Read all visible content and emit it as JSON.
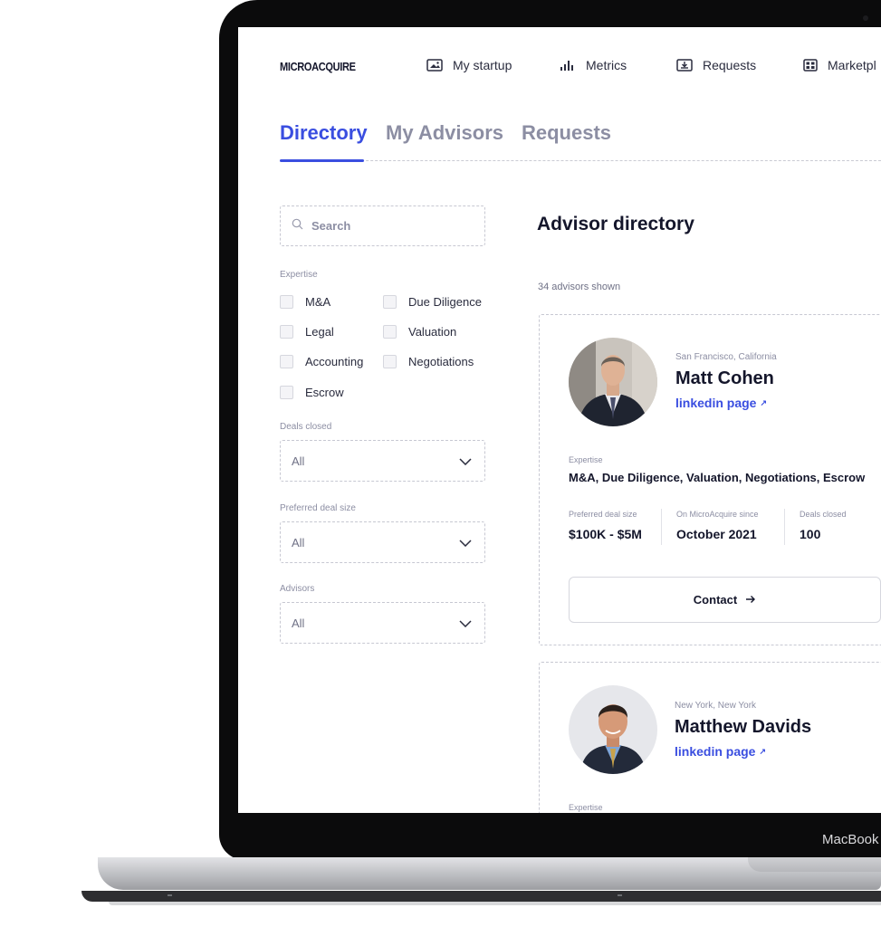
{
  "device": {
    "chin_label": "MacBook"
  },
  "header": {
    "logo": "MICROACQUIRE",
    "nav": [
      {
        "label": "My startup",
        "icon": "image-icon"
      },
      {
        "label": "Metrics",
        "icon": "bar-chart-icon"
      },
      {
        "label": "Requests",
        "icon": "inbox-icon"
      },
      {
        "label": "Marketpl",
        "icon": "grid-icon"
      }
    ]
  },
  "tabs": [
    {
      "label": "Directory",
      "active": true
    },
    {
      "label": "My Advisors",
      "active": false
    },
    {
      "label": "Requests",
      "active": false
    }
  ],
  "sidebar": {
    "search_placeholder": "Search",
    "expertise_label": "Expertise",
    "expertise_options": [
      "M&A",
      "Due Diligence",
      "Legal",
      "Valuation",
      "Accounting",
      "Negotiations",
      "Escrow"
    ],
    "filters": [
      {
        "label": "Deals closed",
        "value": "All"
      },
      {
        "label": "Preferred deal size",
        "value": "All"
      },
      {
        "label": "Advisors",
        "value": "All"
      }
    ]
  },
  "main": {
    "title": "Advisor directory",
    "count_text": "34 advisors shown",
    "advisors": [
      {
        "location": "San Francisco, California",
        "name": "Matt Cohen",
        "link_label": "linkedin page",
        "expertise_label": "Expertise",
        "expertise": "M&A, Due Diligence, Valuation, Negotiations, Escrow",
        "stats": [
          {
            "label": "Preferred deal size",
            "value": "$100K - $5M"
          },
          {
            "label": "On MicroAcquire since",
            "value": "October 2021"
          },
          {
            "label": "Deals closed",
            "value": "100"
          }
        ],
        "contact_label": "Contact"
      },
      {
        "location": "New York, New York",
        "name": "Matthew Davids",
        "link_label": "linkedin page",
        "expertise_label": "Expertise"
      }
    ]
  },
  "colors": {
    "accent": "#3a4ee0",
    "text_dark": "#14162b",
    "muted": "#8c8ea3"
  }
}
